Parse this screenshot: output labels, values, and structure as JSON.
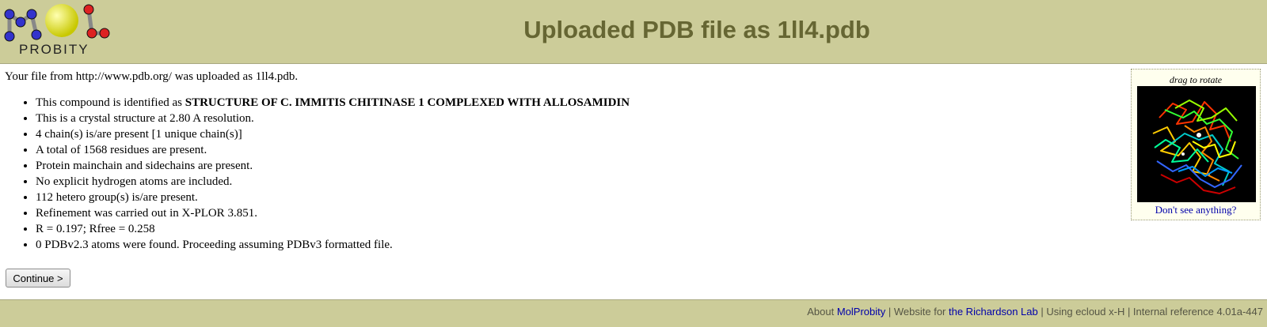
{
  "header": {
    "logo_text": "PROBITY",
    "title": "Uploaded PDB file as 1ll4.pdb"
  },
  "intro": "Your file from http://www.pdb.org/ was uploaded as 1ll4.pdb.",
  "facts": {
    "compound_prefix": "This compound is identified as ",
    "compound_name": "STRUCTURE OF C. IMMITIS CHITINASE 1 COMPLEXED WITH ALLOSAMIDIN",
    "items": [
      "This is a crystal structure at 2.80 A resolution.",
      "4 chain(s) is/are present [1 unique chain(s)]",
      "A total of 1568 residues are present.",
      "Protein mainchain and sidechains are present.",
      "No explicit hydrogen atoms are included.",
      "112 hetero group(s) is/are present.",
      "Refinement was carried out in X-PLOR 3.851.",
      "R = 0.197; Rfree = 0.258",
      "0 PDBv2.3 atoms were found. Proceeding assuming PDBv3 formatted file."
    ]
  },
  "continue_label": "Continue >",
  "viewer": {
    "caption": "drag to rotate",
    "help_link": "Don't see anything?"
  },
  "footer": {
    "about": "About ",
    "molprobity": "MolProbity",
    "website_for": " | Website for ",
    "lab": "the Richardson Lab",
    "rest": " | Using ecloud x-H | Internal reference 4.01a-447"
  },
  "colors": {
    "header_bg": "#cccc99",
    "title": "#666633",
    "link": "#0000aa"
  }
}
